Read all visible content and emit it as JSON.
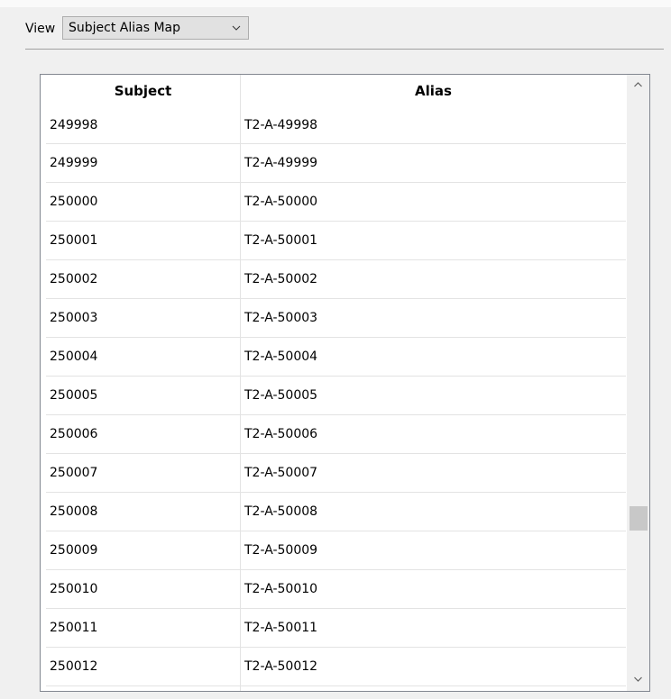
{
  "toolbar": {
    "view_label": "View",
    "view_select": {
      "selected": "Subject Alias Map"
    }
  },
  "table": {
    "columns": [
      "Subject",
      "Alias"
    ],
    "rows": [
      [
        "249998",
        "T2-A-49998"
      ],
      [
        "249999",
        "T2-A-49999"
      ],
      [
        "250000",
        "T2-A-50000"
      ],
      [
        "250001",
        "T2-A-50001"
      ],
      [
        "250002",
        "T2-A-50002"
      ],
      [
        "250003",
        "T2-A-50003"
      ],
      [
        "250004",
        "T2-A-50004"
      ],
      [
        "250005",
        "T2-A-50005"
      ],
      [
        "250006",
        "T2-A-50006"
      ],
      [
        "250007",
        "T2-A-50007"
      ],
      [
        "250008",
        "T2-A-50008"
      ],
      [
        "250009",
        "T2-A-50009"
      ],
      [
        "250010",
        "T2-A-50010"
      ],
      [
        "250011",
        "T2-A-50011"
      ],
      [
        "250012",
        "T2-A-50012"
      ]
    ]
  },
  "scrollbar": {
    "position_fraction": 0.75,
    "up_icon": "chevron-up-icon",
    "down_icon": "chevron-down-icon"
  }
}
